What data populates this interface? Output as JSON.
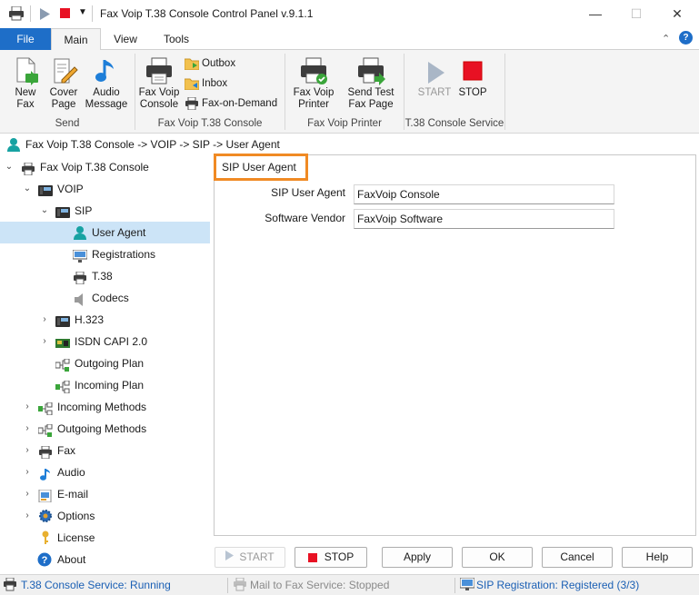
{
  "window": {
    "title": "Fax Voip T.38 Console Control Panel v.9.1.1",
    "minimize": "—",
    "maximize": "☐",
    "close": "✕"
  },
  "ribbon_tabs": {
    "file": "File",
    "main": "Main",
    "view": "View",
    "tools": "Tools"
  },
  "ribbon": {
    "send_group": {
      "caption": "Send",
      "new_fax": "New\nFax",
      "cover_page": "Cover\nPage",
      "audio_message": "Audio\nMessage"
    },
    "console_group": {
      "caption": "Fax Voip T.38 Console",
      "fax_voip_console": "Fax Voip\nConsole",
      "outbox": "Outbox",
      "inbox": "Inbox",
      "fax_on_demand": "Fax-on-Demand"
    },
    "printer_group": {
      "caption": "Fax Voip Printer",
      "fax_voip_printer": "Fax Voip\nPrinter",
      "send_test_fax_page": "Send Test\nFax Page"
    },
    "service_group": {
      "caption": "T.38 Console Service",
      "start": "START",
      "stop": "STOP"
    }
  },
  "breadcrumb": "Fax Voip T.38 Console -> VOIP -> SIP -> User Agent",
  "tree": {
    "root": "Fax Voip T.38 Console",
    "voip": "VOIP",
    "sip": "SIP",
    "user_agent": "User Agent",
    "registrations": "Registrations",
    "t38": "T.38",
    "codecs": "Codecs",
    "h323": "H.323",
    "isdn": "ISDN CAPI 2.0",
    "outgoing_plan": "Outgoing Plan",
    "incoming_plan": "Incoming Plan",
    "incoming_methods": "Incoming Methods",
    "outgoing_methods": "Outgoing Methods",
    "fax": "Fax",
    "audio": "Audio",
    "email": "E-mail",
    "options": "Options",
    "license": "License",
    "about": "About"
  },
  "panel": {
    "group_title": "SIP User Agent",
    "sip_user_agent_label": "SIP User Agent",
    "sip_user_agent_value": "FaxVoip Console",
    "software_vendor_label": "Software Vendor",
    "software_vendor_value": "FaxVoip Software"
  },
  "buttons": {
    "start": "START",
    "stop": "STOP",
    "apply": "Apply",
    "ok": "OK",
    "cancel": "Cancel",
    "help": "Help"
  },
  "status": {
    "service": "T.38 Console Service: Running",
    "mail_to_fax": "Mail to Fax Service: Stopped",
    "sip_registration": "SIP Registration: Registered (3/3)"
  },
  "colors": {
    "accent": "#1e6ec8",
    "highlight": "#f08a24",
    "selection": "#cce4f7",
    "stop_red": "#e81123"
  }
}
